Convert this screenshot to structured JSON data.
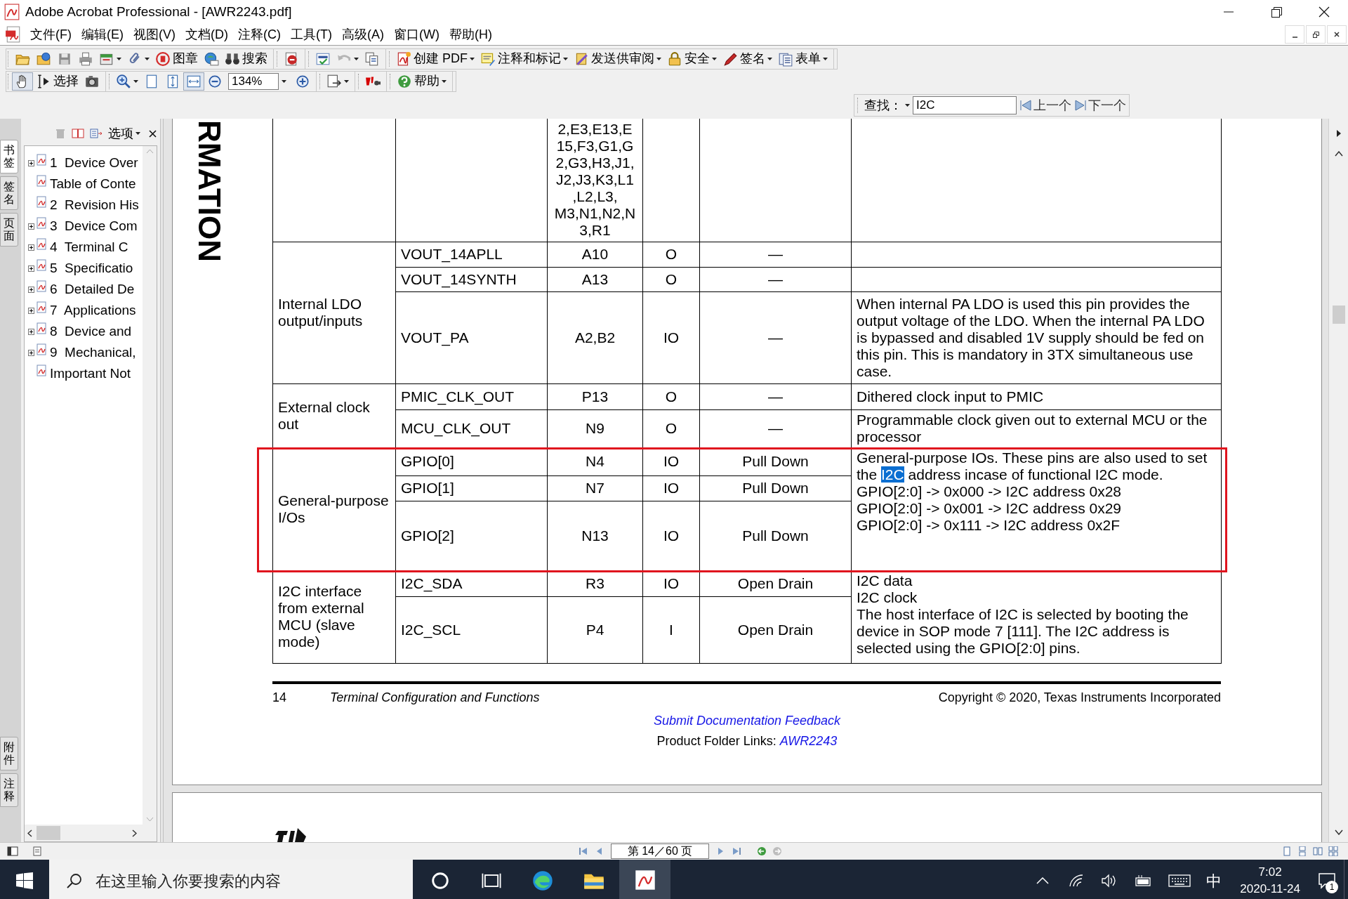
{
  "window": {
    "title": "Adobe Acrobat Professional - [AWR2243.pdf]"
  },
  "menu": [
    "文件(F)",
    "编辑(E)",
    "视图(V)",
    "文档(D)",
    "注释(C)",
    "工具(T)",
    "高级(A)",
    "窗口(W)",
    "帮助(H)"
  ],
  "toolbar_1": [
    [
      {
        "dropdown": false
      },
      {
        "dropdown": false
      },
      {
        "dropdown": false
      },
      {
        "dropdown": false
      },
      {
        "dropdown": true
      },
      {
        "dropdown": true
      },
      {
        "label": "图章",
        "dropdown": false
      },
      {
        "dropdown": false
      },
      {
        "label": "搜索",
        "dropdown": false
      }
    ],
    [
      {
        "dropdown": false
      }
    ],
    [
      {
        "dropdown": false
      },
      {
        "dropdown": true
      },
      {
        "dropdown": false
      }
    ],
    [
      {
        "label": "创建 PDF",
        "dropdown": true
      },
      {
        "label": "注释和标记",
        "dropdown": true
      },
      {
        "label": "发送供审阅",
        "dropdown": true
      },
      {
        "label": "安全",
        "dropdown": true
      },
      {
        "label": "签名",
        "dropdown": true
      },
      {
        "label": "表单",
        "dropdown": true
      }
    ]
  ],
  "toolbar_2": [
    [
      {
        "kind": "button",
        "selected": true,
        "dropdown": false
      },
      {
        "kind": "button",
        "label": "选择",
        "selected": false,
        "dropdown": false
      },
      {
        "kind": "button",
        "selected": false,
        "dropdown": false
      }
    ],
    [
      {
        "kind": "button",
        "selected": false,
        "dropdown": true
      },
      {
        "kind": "button",
        "selected": false,
        "dropdown": false
      },
      {
        "kind": "button",
        "selected": false,
        "dropdown": false
      },
      {
        "kind": "button",
        "selected": true,
        "dropdown": false
      },
      {
        "kind": "button",
        "selected": false,
        "dropdown": false
      },
      {
        "kind": "combo",
        "value": "134%"
      },
      {
        "kind": "button",
        "selected": false,
        "dropdown": false
      }
    ],
    [
      {
        "kind": "button",
        "selected": false,
        "dropdown": true
      }
    ],
    [
      {
        "kind": "button",
        "selected": false,
        "dropdown": false
      }
    ],
    [
      {
        "kind": "button",
        "label": "帮助",
        "selected": false,
        "dropdown": true
      }
    ]
  ],
  "find_bar": {
    "label": "查找：",
    "value": "I2C",
    "previous": "上一个",
    "next": "下一个"
  },
  "side_tabs_top": [
    {
      "label": "书签",
      "selected": true
    },
    {
      "label": "签名",
      "selected": false
    },
    {
      "label": "页面",
      "selected": false
    }
  ],
  "side_tabs_bottom": [
    {
      "label": "附件",
      "selected": false
    },
    {
      "label": "注释",
      "selected": false
    }
  ],
  "bookmarks_panel": {
    "options": "选项",
    "items": [
      {
        "label": "1  Device Over",
        "expanded": false
      },
      {
        "label": "Table of Conte"
      },
      {
        "label": "2  Revision His"
      },
      {
        "label": "3  Device Com",
        "expanded": false
      },
      {
        "label": "4  Terminal C",
        "expanded": false
      },
      {
        "label": "5  Specificatio",
        "expanded": false
      },
      {
        "label": "6  Detailed De",
        "expanded": false
      },
      {
        "label": "7  Applications",
        "expanded": false
      },
      {
        "label": "8  Device and",
        "expanded": false
      },
      {
        "label": "9  Mechanical,",
        "expanded": false
      },
      {
        "label": "Important Not"
      }
    ]
  },
  "document": {
    "side_heading": "RMATION",
    "pin_table": {
      "groups": [
        {
          "rows": [
            {
              "balls": "2,E3,E13,E\n15,F3,G1,G\n2,G3,H3,J1,\nJ2,J3,K3,L1\n,L2,L3,\nM3,N1,N2,N\n3,R1"
            }
          ]
        },
        {
          "function": "Internal LDO output/inputs",
          "rows": [
            {
              "signal": "VOUT_14APLL",
              "balls": "A10",
              "type": "O",
              "pull": "—"
            },
            {
              "signal": "VOUT_14SYNTH",
              "balls": "A13",
              "type": "O",
              "pull": "—"
            },
            {
              "signal": "VOUT_PA",
              "balls": "A2,B2",
              "type": "IO",
              "pull": "—",
              "description": "When internal PA LDO is used this pin provides the output voltage of the LDO. When the internal PA LDO is bypassed and disabled 1V supply should be fed on this pin. This is mandatory in 3TX simultaneous use case."
            }
          ]
        },
        {
          "function": "External clock out",
          "rows": [
            {
              "signal": "PMIC_CLK_OUT",
              "balls": "P13",
              "type": "O",
              "pull": "—",
              "description": "Dithered clock input to PMIC"
            },
            {
              "signal": "MCU_CLK_OUT",
              "balls": "N9",
              "type": "O",
              "pull": "—",
              "description": "Programmable clock given out to external MCU or the processor"
            }
          ]
        },
        {
          "function": "General-purpose I/Os",
          "framed": true,
          "description": [
            {
              "kind": "runs",
              "runs": [
                {
                  "text": "General-purpose IOs. These pins are also used to set the ",
                  "highlighted": false
                },
                {
                  "text": "I2C",
                  "highlighted": true
                },
                {
                  "text": " address incase of functional I2C mode.",
                  "highlighted": false
                }
              ]
            },
            {
              "kind": "list",
              "text": "GPIO[2:0] -> 0x000 -> I2C address 0x28\nGPIO[2:0] -> 0x001 -> I2C address 0x29\nGPIO[2:0] -> 0x111 -> I2C address 0x2F"
            }
          ],
          "rows": [
            {
              "signal": "GPIO[0]",
              "balls": "N4",
              "type": "IO",
              "pull": "Pull Down"
            },
            {
              "signal": "GPIO[1]",
              "balls": "N7",
              "type": "IO",
              "pull": "Pull Down"
            },
            {
              "signal": "GPIO[2]",
              "balls": "N13",
              "type": "IO",
              "pull": "Pull Down"
            }
          ]
        },
        {
          "function": "I2C interface from external MCU (slave mode)",
          "framed": false,
          "description": [
            {
              "kind": "text",
              "text": "I2C data"
            },
            {
              "kind": "text",
              "text": "I2C clock"
            },
            {
              "kind": "text",
              "text": "The host interface of I2C is selected by booting the device in SOP mode 7 [111]. The I2C address is selected using the GPIO[2:0] pins."
            }
          ],
          "rows": [
            {
              "signal": "I2C_SDA",
              "balls": "R3",
              "type": "IO",
              "pull": "Open Drain"
            },
            {
              "signal": "I2C_SCL",
              "balls": "P4",
              "type": "I",
              "pull": "Open Drain"
            }
          ]
        }
      ]
    },
    "footer": {
      "page_number": "14",
      "section": "Terminal Configuration and Functions",
      "copyright": "Copyright © 2020, Texas Instruments Incorporated",
      "feedback_link": "Submit Documentation Feedback",
      "links_label": "Product Folder Links: ",
      "product_link": "AWR2243"
    }
  },
  "status_bar": {
    "page": "第 14／60 页"
  },
  "taskbar": {
    "search_placeholder": "在这里输入你要搜索的内容",
    "apps": [
      {
        "selected": false
      },
      {
        "selected": false
      },
      {
        "selected": false
      },
      {
        "selected": false
      },
      {
        "selected": true
      }
    ],
    "ime": "中",
    "time": "7:02",
    "date": "2020-11-24",
    "notifications": "1"
  }
}
